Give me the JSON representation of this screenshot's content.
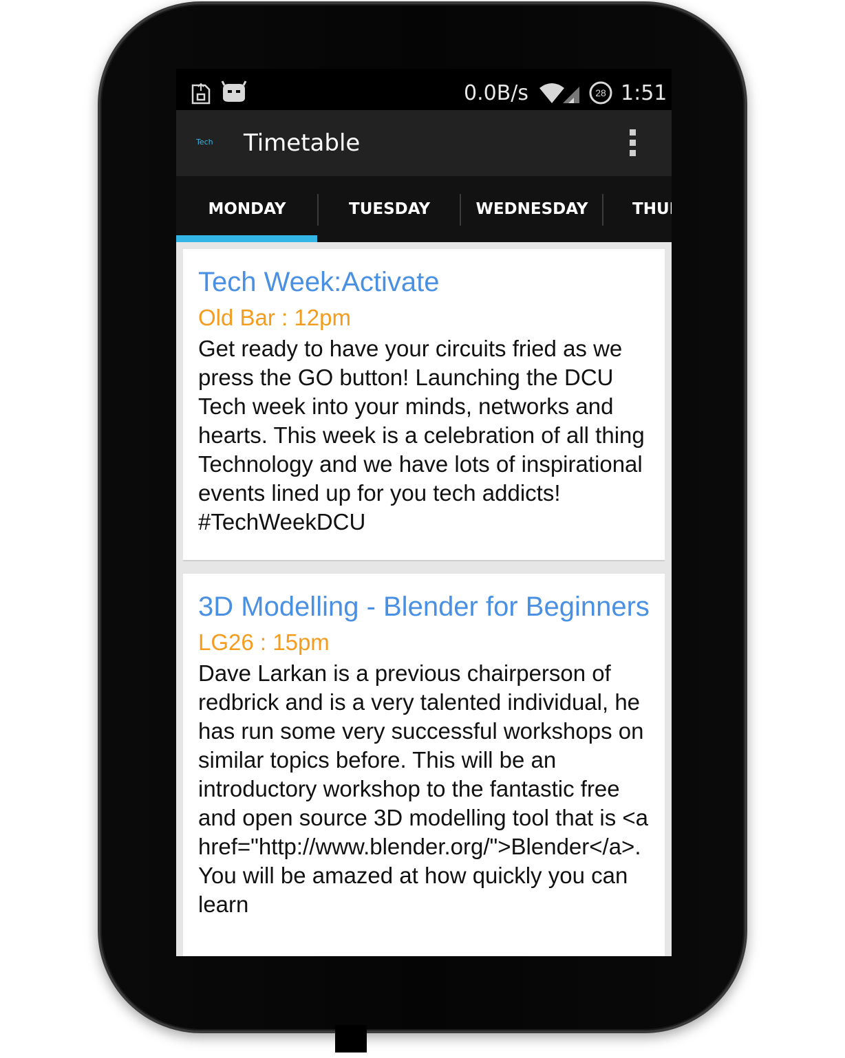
{
  "status_bar": {
    "left_icons": [
      "sd-card-icon",
      "android-cyanogen-icon"
    ],
    "network_speed": "0.0B/s",
    "battery_badge": "28",
    "time": "1:51"
  },
  "action_bar": {
    "logo_text": "Tech",
    "title": "Timetable",
    "overflow_icon": "overflow-menu-icon"
  },
  "tabs": [
    {
      "label": "MONDAY",
      "selected": true
    },
    {
      "label": "TUESDAY",
      "selected": false
    },
    {
      "label": "WEDNESDAY",
      "selected": false
    },
    {
      "label": "THUR",
      "selected": false
    }
  ],
  "colors": {
    "accent": "#33b5e5",
    "title_blue": "#4a90e2",
    "location_orange": "#f39c1e"
  },
  "events": [
    {
      "title": "Tech Week:Activate",
      "location": "Old Bar : 12pm",
      "description": "Get ready to have your circuits fried as we press the GO button! Launching the DCU Tech week into your minds, networks and hearts. This week is a celebration of all thing Technology and we have lots of inspirational events lined up for you tech addicts! #TechWeekDCU"
    },
    {
      "title": "3D Modelling - Blender for Beginners",
      "location": "LG26 : 15pm",
      "description": "Dave Larkan is a previous chairperson of redbrick and is a very talented individual, he has run some very successful workshops on similar topics before. This will be an introductory workshop to the fantastic free and open source 3D modelling tool that is <a href=\"http://www.blender.org/\">Blender</a>. You will be amazed at how quickly you can learn"
    }
  ]
}
